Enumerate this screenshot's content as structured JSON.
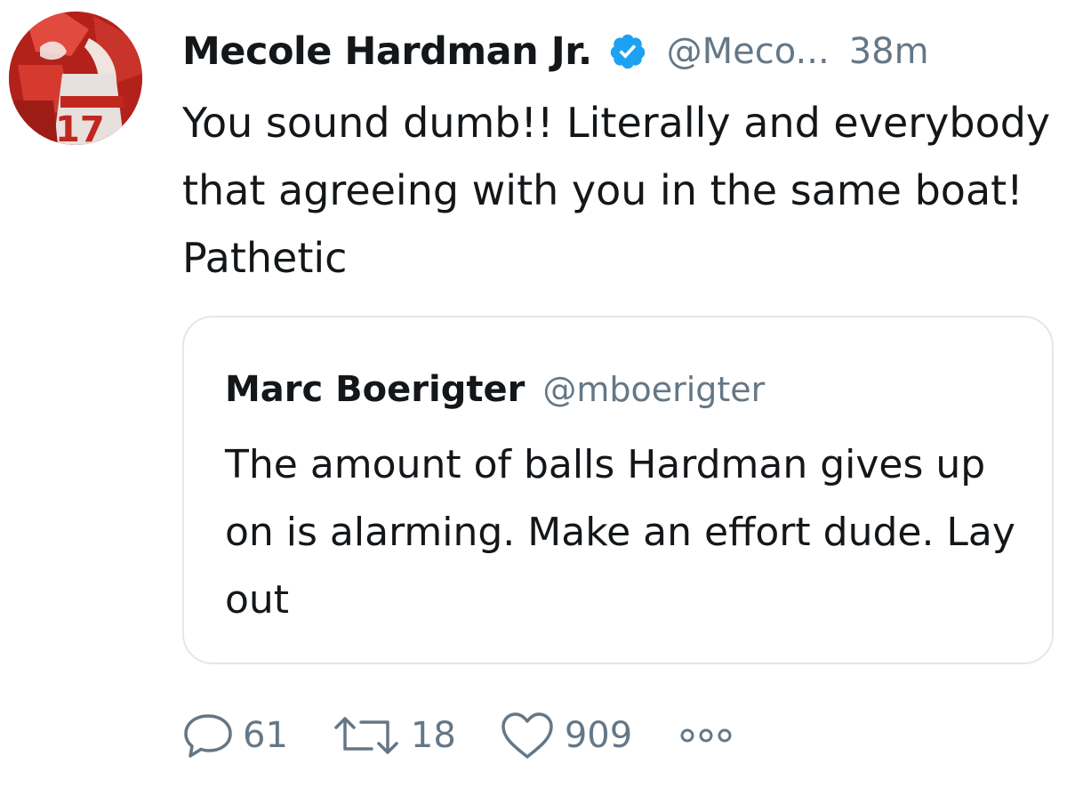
{
  "tweet": {
    "author_name": "Mecole Hardman Jr.",
    "author_handle": "@Meco...",
    "timestamp": "38m",
    "text": "You sound dumb!! Literally and everybody that agreeing with you in the same boat! Pathetic",
    "avatar_number": "17"
  },
  "quoted_tweet": {
    "author_name": "Marc Boerigter",
    "author_handle": "@mboerigter",
    "text": "The amount of balls Hardman gives up on is alarming. Make an effort dude. Lay out"
  },
  "actions": {
    "reply_count": "61",
    "retweet_count": "18",
    "like_count": "909"
  },
  "icons": {
    "verified": "verified-badge-icon",
    "reply": "reply-icon",
    "retweet": "retweet-icon",
    "like": "heart-icon",
    "more": "more-dots-icon"
  },
  "colors": {
    "verified_blue": "#1da1f2",
    "secondary_text": "#657786",
    "primary_text": "#14171a",
    "border": "#e1e8ed"
  }
}
